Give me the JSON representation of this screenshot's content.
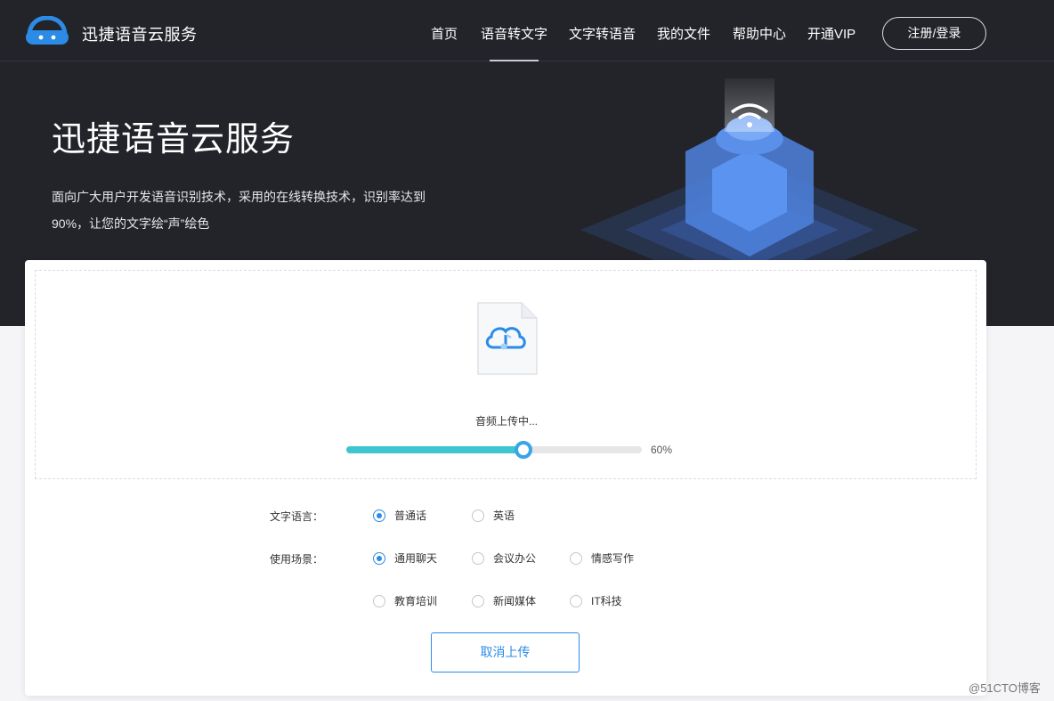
{
  "brand": {
    "name": "迅捷语音云服务"
  },
  "nav": {
    "items": [
      {
        "label": "首页"
      },
      {
        "label": "语音转文字"
      },
      {
        "label": "文字转语音"
      },
      {
        "label": "我的文件"
      },
      {
        "label": "帮助中心"
      },
      {
        "label": "开通VIP"
      }
    ],
    "active_item": "语音转文字",
    "login_label": "注册/登录"
  },
  "hero": {
    "title": "迅捷语音云服务",
    "desc_line1": "面向广大用户开发语音识别技术，采用的在线转换技术，识别率达到",
    "desc_line2": "90%，让您的文字绘“声”绘色"
  },
  "upload": {
    "status": "音频上传中...",
    "progress": 0.6,
    "progress_text": "60%"
  },
  "options": {
    "language_label": "文字语言：",
    "language_choices": [
      {
        "label": "普通话",
        "checked": true
      },
      {
        "label": "英语",
        "checked": false
      }
    ],
    "scene_label": "使用场景：",
    "scene_choices": [
      {
        "label": "通用聊天",
        "checked": true
      },
      {
        "label": "会议办公",
        "checked": false
      },
      {
        "label": "情感写作",
        "checked": false
      },
      {
        "label": "教育培训",
        "checked": false
      },
      {
        "label": "新闻媒体",
        "checked": false
      },
      {
        "label": "IT科技",
        "checked": false
      }
    ]
  },
  "cancel_label": "取消上传",
  "watermark": "@51CTO博客",
  "colors": {
    "hero_bg": "#22242a",
    "accent": "#2b8be6",
    "progress": "#3ec5cf"
  }
}
